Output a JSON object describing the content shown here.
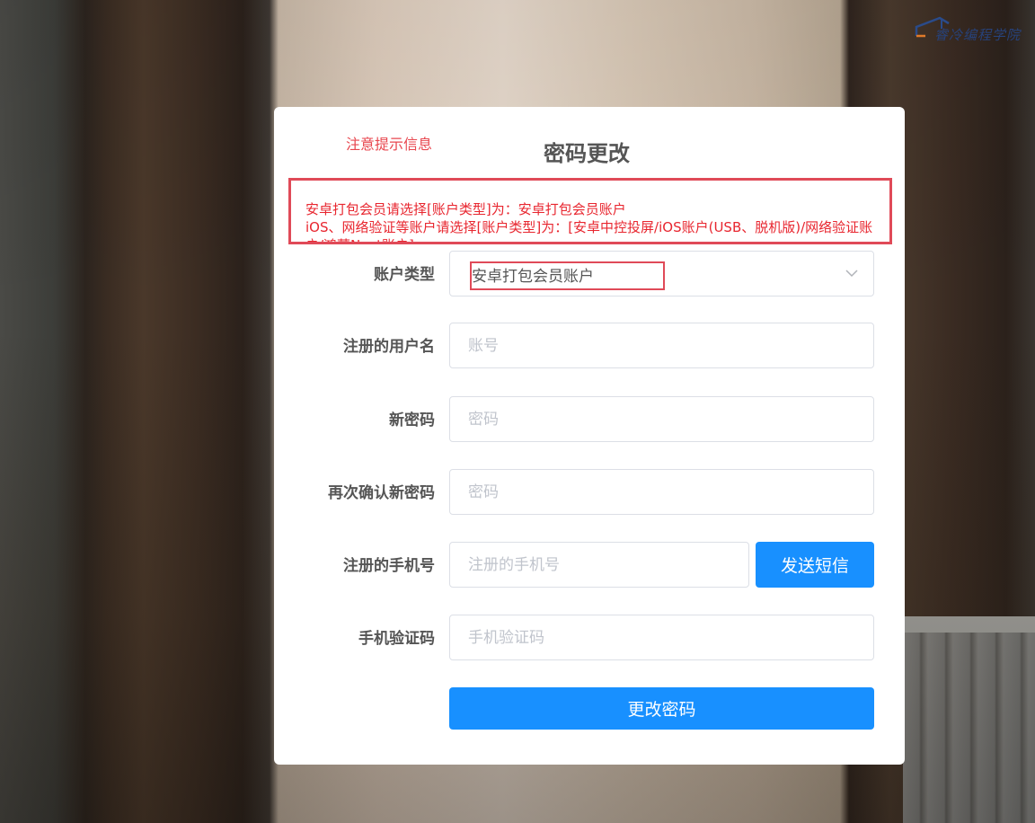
{
  "logo": {
    "text": "睿冷编程学院"
  },
  "notice": {
    "title": "注意提示信息",
    "lines": [
      "安卓打包会员请选择[账户类型]为：安卓打包会员账户",
      "iOS、网络验证等账户请选择[账户类型]为：[安卓中控投屏/iOS账户(USB、脱机版)/网络验证账户/鸿蒙Next账户]"
    ],
    "highlight_color": "#e04a58"
  },
  "form": {
    "title": "密码更改",
    "account_type": {
      "label": "账户类型",
      "selected": "安卓打包会员账户",
      "icon": "chevron-down-icon"
    },
    "username": {
      "label": "注册的用户名",
      "placeholder": "账号",
      "value": ""
    },
    "new_password": {
      "label": "新密码",
      "placeholder": "密码",
      "value": ""
    },
    "confirm_password": {
      "label": "再次确认新密码",
      "placeholder": "密码",
      "value": ""
    },
    "phone": {
      "label": "注册的手机号",
      "placeholder": "注册的手机号",
      "value": "",
      "send_sms_label": "发送短信"
    },
    "sms_code": {
      "label": "手机验证码",
      "placeholder": "手机验证码",
      "value": ""
    },
    "submit_label": "更改密码"
  },
  "colors": {
    "primary": "#1890ff",
    "warning_text": "#e8262f",
    "label_text": "#555555"
  }
}
